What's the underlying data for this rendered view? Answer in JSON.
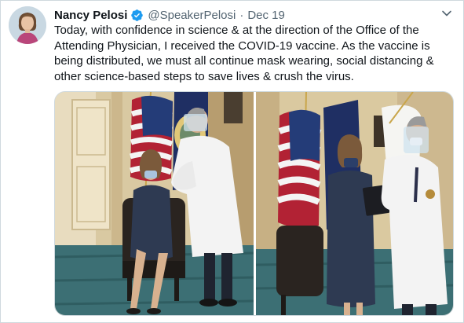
{
  "tweet": {
    "author_name": "Nancy Pelosi",
    "handle": "@SpeakerPelosi",
    "separator": "·",
    "date": "Dec 19",
    "text": "Today, with confidence in science & at the direction of the Office of the Attending Physician, I received the COVID-19 vaccine. As the vaccine is being distributed, we must all continue mask wearing, social distancing & other science-based steps to save lives & crush the virus."
  },
  "icons": {
    "verified": "verified-badge-icon",
    "more": "chevron-down-icon"
  },
  "colors": {
    "verified": "#1d9bf0",
    "secondary_text": "#536471",
    "border": "#cfd9de"
  }
}
